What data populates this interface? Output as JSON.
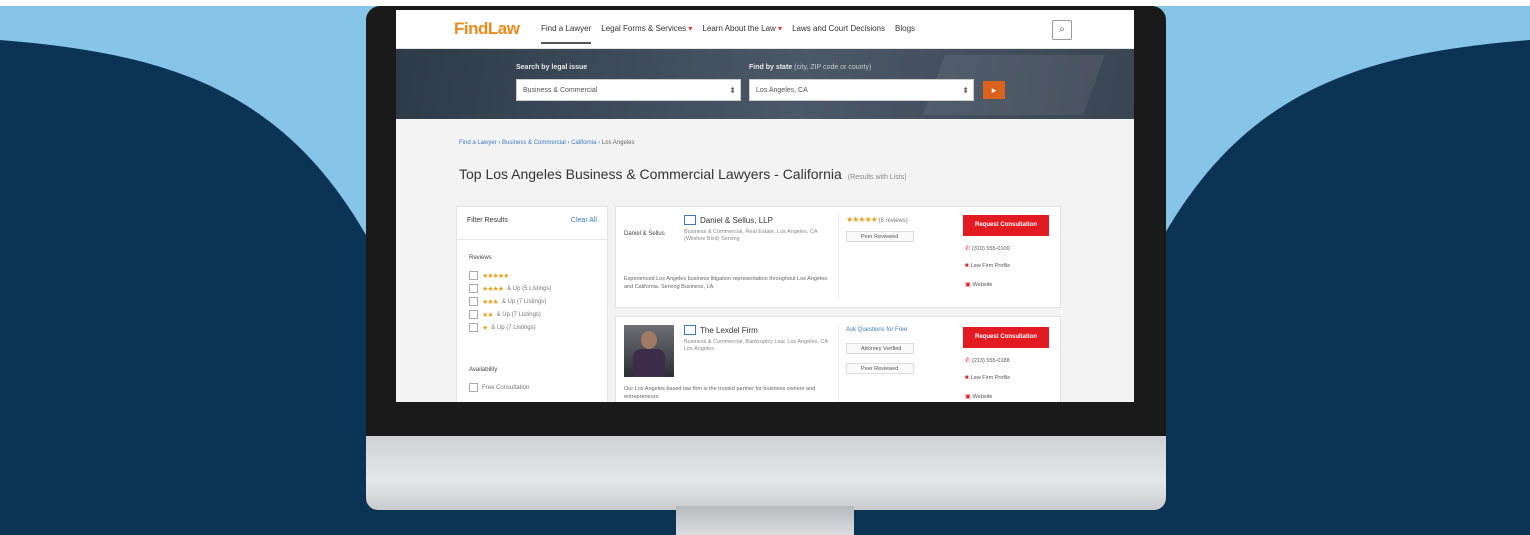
{
  "colors": {
    "background_navy": "#0b3355",
    "sky_blue": "#86c5e8",
    "brand_orange": "#f08a1d",
    "cta_red": "#e21b23",
    "link_blue": "#3a7bc0"
  },
  "nav": {
    "logo": "FindLaw",
    "items": [
      {
        "label": "Find a Lawyer",
        "active": true
      },
      {
        "label": "Legal Forms & Services",
        "caret": "▾"
      },
      {
        "label": "Learn About the Law",
        "caret": "▾"
      },
      {
        "label": "Laws and Court Decisions"
      },
      {
        "label": "Blogs"
      }
    ],
    "search_icon": "magnifier-icon",
    "search_glyph": "⌕"
  },
  "hero": {
    "issue_label": "Search by legal issue",
    "location_label": "Find by state",
    "location_sub": "(city, ZIP code or county)",
    "issue_value": "Business & Commercial",
    "location_value": "Los Angeles, CA",
    "select_arrow": "⬍",
    "go_glyph": "▸"
  },
  "breadcrumb": {
    "items": [
      "Find a Lawyer",
      "Business & Commercial",
      "California"
    ],
    "separator": "›",
    "current": "Los Angeles"
  },
  "page": {
    "title": "Top Los Angeles Business & Commercial Lawyers - California",
    "result_count": "(Results with Lists)"
  },
  "filters": {
    "heading": "Filter Results",
    "clear": "Clear All",
    "rating_heading": "Reviews",
    "ratings": [
      {
        "stars": "★★★★★",
        "label": ""
      },
      {
        "stars": "★★★★",
        "label": "& Up (5 Listings)"
      },
      {
        "stars": "★★★",
        "label": "& Up (7 Listings)"
      },
      {
        "stars": "★★",
        "label": "& Up (7 Listings)"
      },
      {
        "stars": "★",
        "label": "& Up (7 Listings)"
      }
    ],
    "availability_heading": "Availability",
    "availability_option": "Free Consultation"
  },
  "listings": [
    {
      "firm": "Daniel & Sellus, LLP",
      "logo_text": "Daniel & Sellus",
      "address": "Business & Commercial, Real Estate, Los Angeles, CA (Wilshire Blvd) Serving",
      "description": "Experienced Los Angeles business litigation representation throughout Los Angeles and California. Serving Business, LA.",
      "stars": "★★★★★",
      "review_count": "(8 reviews)",
      "tag": "Peer Reviewed",
      "cta": "Request Consultation",
      "actions": [
        "(310) 555-0100",
        "Law Firm Profile",
        "Website"
      ]
    },
    {
      "firm": "The Lexdel Firm",
      "address": "Business & Commercial, Bankruptcy Law, Los Angeles, CA Los Angeles",
      "description": "Our Los Angeles-based law firm is the trusted partner for business owners and entrepreneurs.",
      "link": "Ask Questions for Free",
      "tags": [
        "Attorney Verified",
        "Peer Reviewed"
      ],
      "cta": "Request Consultation",
      "actions": [
        "(213) 555-0188",
        "Law Firm Profile",
        "Website"
      ]
    }
  ],
  "icons": {
    "phone": "phone-icon",
    "profile": "profile-icon",
    "website": "website-icon"
  }
}
